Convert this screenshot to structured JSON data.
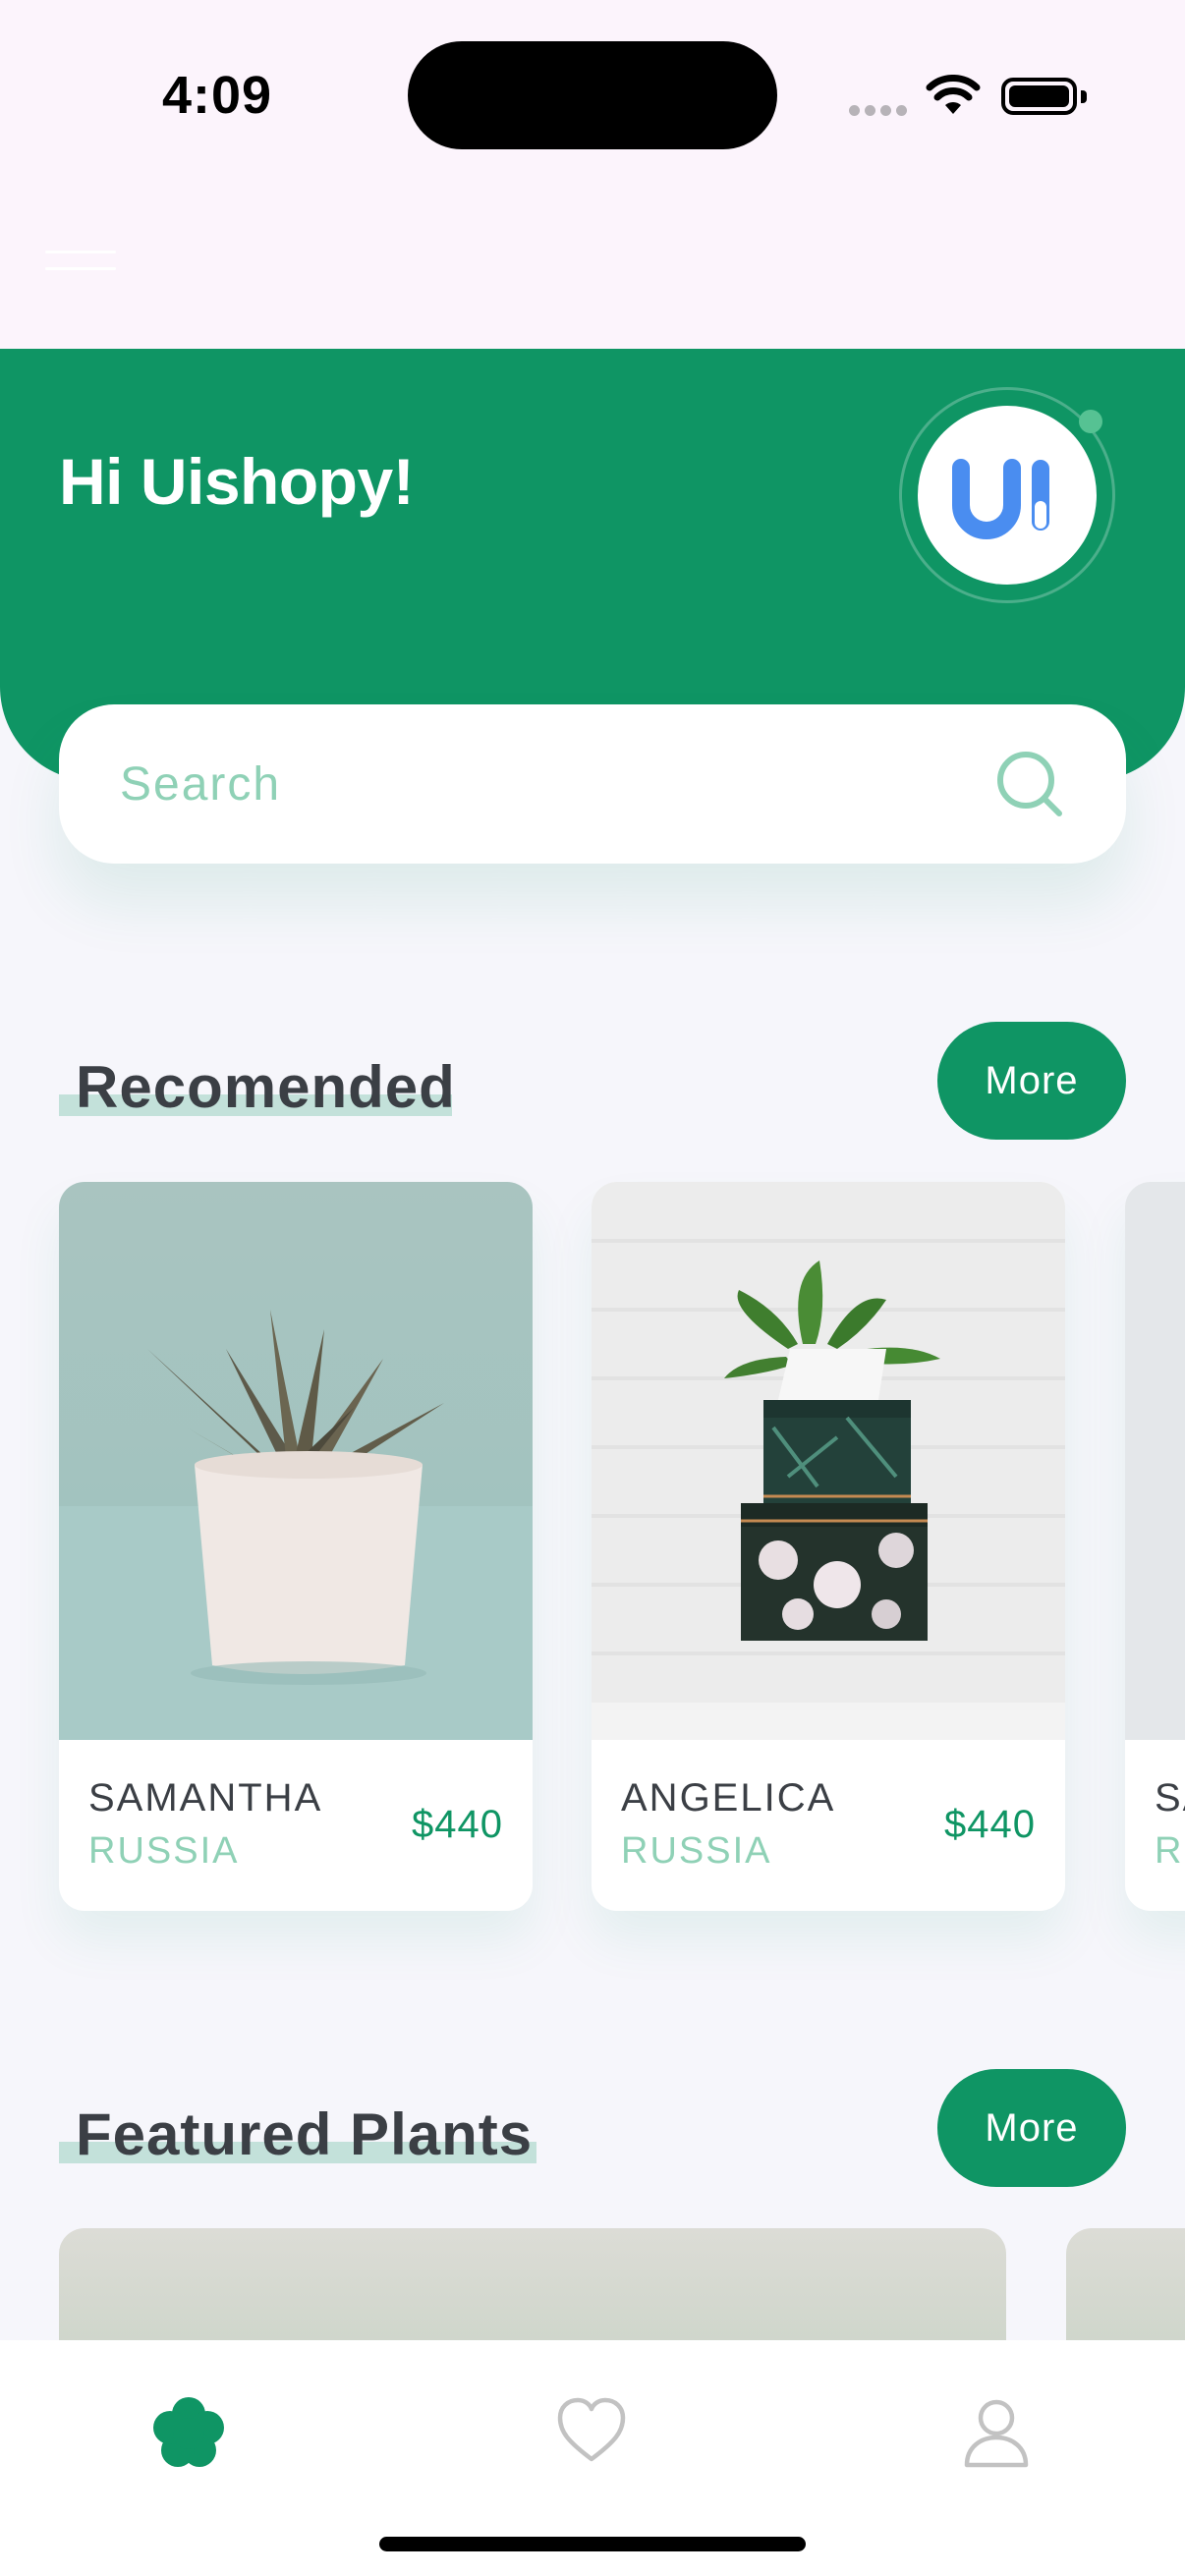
{
  "status_bar": {
    "time": "4:09"
  },
  "header": {
    "greeting": "Hi Uishopy!",
    "avatar_logo": "UI",
    "accent": "#0f9564"
  },
  "search": {
    "placeholder": "Search"
  },
  "recommended": {
    "title": "Recomended",
    "more_label": "More",
    "items": [
      {
        "name": "SAMANTHA",
        "country": "RUSSIA",
        "price": "$440"
      },
      {
        "name": "ANGELICA",
        "country": "RUSSIA",
        "price": "$440"
      },
      {
        "name": "SA",
        "country": "R",
        "price": ""
      }
    ]
  },
  "featured": {
    "title": "Featured Plants",
    "more_label": "More"
  },
  "bottom_nav": {
    "items": [
      "flower-icon",
      "heart-icon",
      "user-icon"
    ],
    "active": 0
  }
}
